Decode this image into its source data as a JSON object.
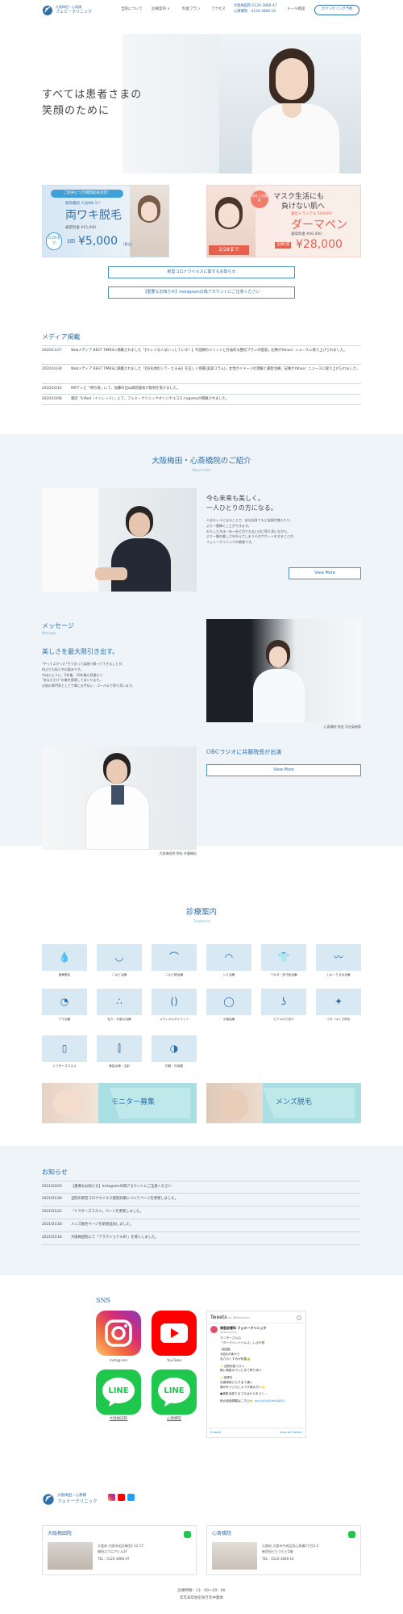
{
  "header": {
    "logo_line1": "大阪梅田・心斎橋",
    "logo_line2": "フェミークリニック",
    "nav": [
      "当院について",
      "診療案内 ∨",
      "料金プラン",
      "アクセス"
    ],
    "phone_umeda": "大阪梅田院 0120-3868-47",
    "phone_shinsaibashi": "心斎橋院　0120-3868-16",
    "mail_label": "メール相談",
    "counseling_button": "カウンセリング予約"
  },
  "hero": {
    "line1": "すべては患者さまの",
    "line2": "笑顔のために"
  },
  "banners": {
    "left": {
      "badge": "ご好評につき期間延長決定！",
      "sub": "新年最初 人気NO.1!!",
      "title": "両ワキ脱毛",
      "normal": "通常料金 ¥15,000",
      "times": "5回",
      "price": "¥5,000",
      "tax": "(税込)",
      "deadline": "2/28まで"
    },
    "right": {
      "badge": "初めて方限定",
      "title_a": "マスク生活にも",
      "title_b": "負けない肌へ",
      "sub": "部位トライアル 50%OFF",
      "product": "ダーマペン",
      "normal": "通常料金 ¥56,000",
      "times": "全顔1回",
      "price": "¥28,000",
      "deadline": "2/28まで"
    }
  },
  "notice_buttons": [
    "新型コロナウイルスに関するお知らせ",
    "【重要なお知らせ】Instagramの偽アカウントにご注意ください"
  ],
  "media": {
    "title": "メディア掲載",
    "items": [
      {
        "date": "2020/11/27",
        "text": "Webメディア BEST TIMESに掲載されました「【キレイな人はいっしている？】今話題のメリットと計画的な整形プランの提案」記事がYahoo！ニュースに取り上げられました。"
      },
      {
        "date": "2020/10/30",
        "text": "Webメディア BEST TIMESに掲載されました「【有名顔のシワ・たるみ】を正しく把握(美容コラム)」女性がイメージの理解と最新治療」記事がYahoo！ニュースに取り上げられました。"
      },
      {
        "date": "2020/10/14",
        "text": "MXテレビ「男の道」にて、加藤の出山病院施術が取材を受けました。"
      },
      {
        "date": "2020/10/08",
        "text": "雑誌「InRed（インレッド）」にて、フェミークリニックオリジナルコスメagomaが掲載されました。"
      }
    ]
  },
  "intro": {
    "title": "大阪梅田・心斎橋院のご紹介",
    "en": "About clinic",
    "heading1": "今も未来も美しく。",
    "heading2": "一人ひとりの方になる。",
    "body": [
      "人はキレイになることで、自分自身でもと笑顔が増えたり、",
      "より一層輝くことができます。",
      "わたしたちは一歩一歩と目でもない方に寄り添いながら、",
      "より一層の美しさを叶えてしまうそのサポートをすることが、",
      "フェミークリニックの患者です。"
    ],
    "view_more": "View More"
  },
  "message": {
    "title": "メッセージ",
    "en": "Message",
    "heading": "美しさを最大限引き出す。",
    "body": [
      "\"やってよかった\"そう言って笑顔で帰って下さることが、",
      "何よりも私たちの励みです。",
      "今ほんとうに、5年後、10年後も見据えて",
      "\"あなただけ\"の美を実現してまいります。",
      "お肌の専門家として丁寧にお手伝い、ゴールまで寄り添います。"
    ],
    "photo_caption": "心斎橋院 院長 河村英樹等",
    "doctor_caption": "大阪梅田院 院長 井藤郷紀",
    "radio_title": "OBCラジオに井藤院長が出演",
    "view_more": "View More"
  },
  "treatment": {
    "title": "診療案内",
    "en": "Treatment",
    "items": [
      "医療脱毛",
      "ニキビ治療",
      "ニキビ跡治療",
      "シミ治療",
      "ワキガ・多汗症治療",
      "しわ・たるみ治療",
      "クマ治療",
      "毛穴・お肌の治療",
      "メディカルダイエット",
      "小顔治療",
      "ピアスの穴あけ",
      "イボ・ほくろ除去",
      "ドクターズコスメ",
      "美容点滴・注射",
      "内服・外用薬"
    ],
    "monitor": "モニター募集",
    "mens": "メンズ脱毛"
  },
  "news": {
    "title": "お知らせ",
    "items": [
      {
        "date": "2021/02/03",
        "text": "【重要なお知らせ】Instagramの偽アカウントにご注意ください"
      },
      {
        "date": "2021/01/28",
        "date_text": "当院の新型コロナウイルス感染対策についてページを更新しました。"
      },
      {
        "date": "2021/01/22",
        "text": "「ドクターズコスメ」ページを更新しました。"
      },
      {
        "date": "2021/01/18",
        "text": "メンズ脱毛ページを新規追加しました。"
      },
      {
        "date": "2021/01/18",
        "text": "大阪梅田院にて「フラクショナルRF」を導入しました。"
      }
    ]
  },
  "sns": {
    "title": "SNS",
    "instagram": "instagram",
    "youtube": "YouTube",
    "line_umeda": "大阪梅田院",
    "line_shinsaibashi": "心斎橋院",
    "line_text": "LINE",
    "tweets": {
      "header": "Tweets",
      "by": "by @femyclinic",
      "account": "美容皮膚科 フェミークリニック",
      "handle": "@femyclinic",
      "lines": [
        "モニターさんの",
        "「ダーマペン＋ヘルス」レポ②🌿",
        "",
        "【経過】",
        "1回目の後から",
        "毛穴のくすみが改善👍",
        "",
        "✨当院化粧コスト",
        "無い美肌のマシにまで寄り添う",
        "",
        "✨皮膚を",
        "毛施術後にもり全て通い",
        "美が叶うさらにカラダ美の方へ⭐",
        "",
        "●美肌全部たるコスはからまぶく...",
        "",
        "他の経過掲載はこちら👉"
      ],
      "link": "ow.ly/JSvX5mW4iDQ",
      "embed": "Embed",
      "view": "View on Twitter"
    }
  },
  "footer": {
    "logo_line1": "大阪梅田・心斎橋",
    "logo_line2": "フェミークリニック",
    "umeda": {
      "name": "大阪梅田院",
      "address": "大阪府 大阪市北区梅田1-12-17",
      "building": "梅田スクエアビル2F",
      "tel": "TEL：0120-3868-47"
    },
    "shinsaibashi": {
      "name": "心斎橋院",
      "address": "大阪府 大阪市中央区西心斎橋2丁目1-2",
      "building": "新世紀ビビクビビ5階",
      "tel": "TEL：0120-3868-16"
    },
    "hours": "診療時間：11：00〜20：00",
    "closed": "年年末年始を除き年中無休"
  },
  "colors": {
    "accent": "#2e6fa8",
    "light_bg": "#eef4f8",
    "tile_bg": "#d8e9f3",
    "teal": "#a9dfe3",
    "line_green": "#1fc84d",
    "youtube_red": "#ff0000"
  }
}
